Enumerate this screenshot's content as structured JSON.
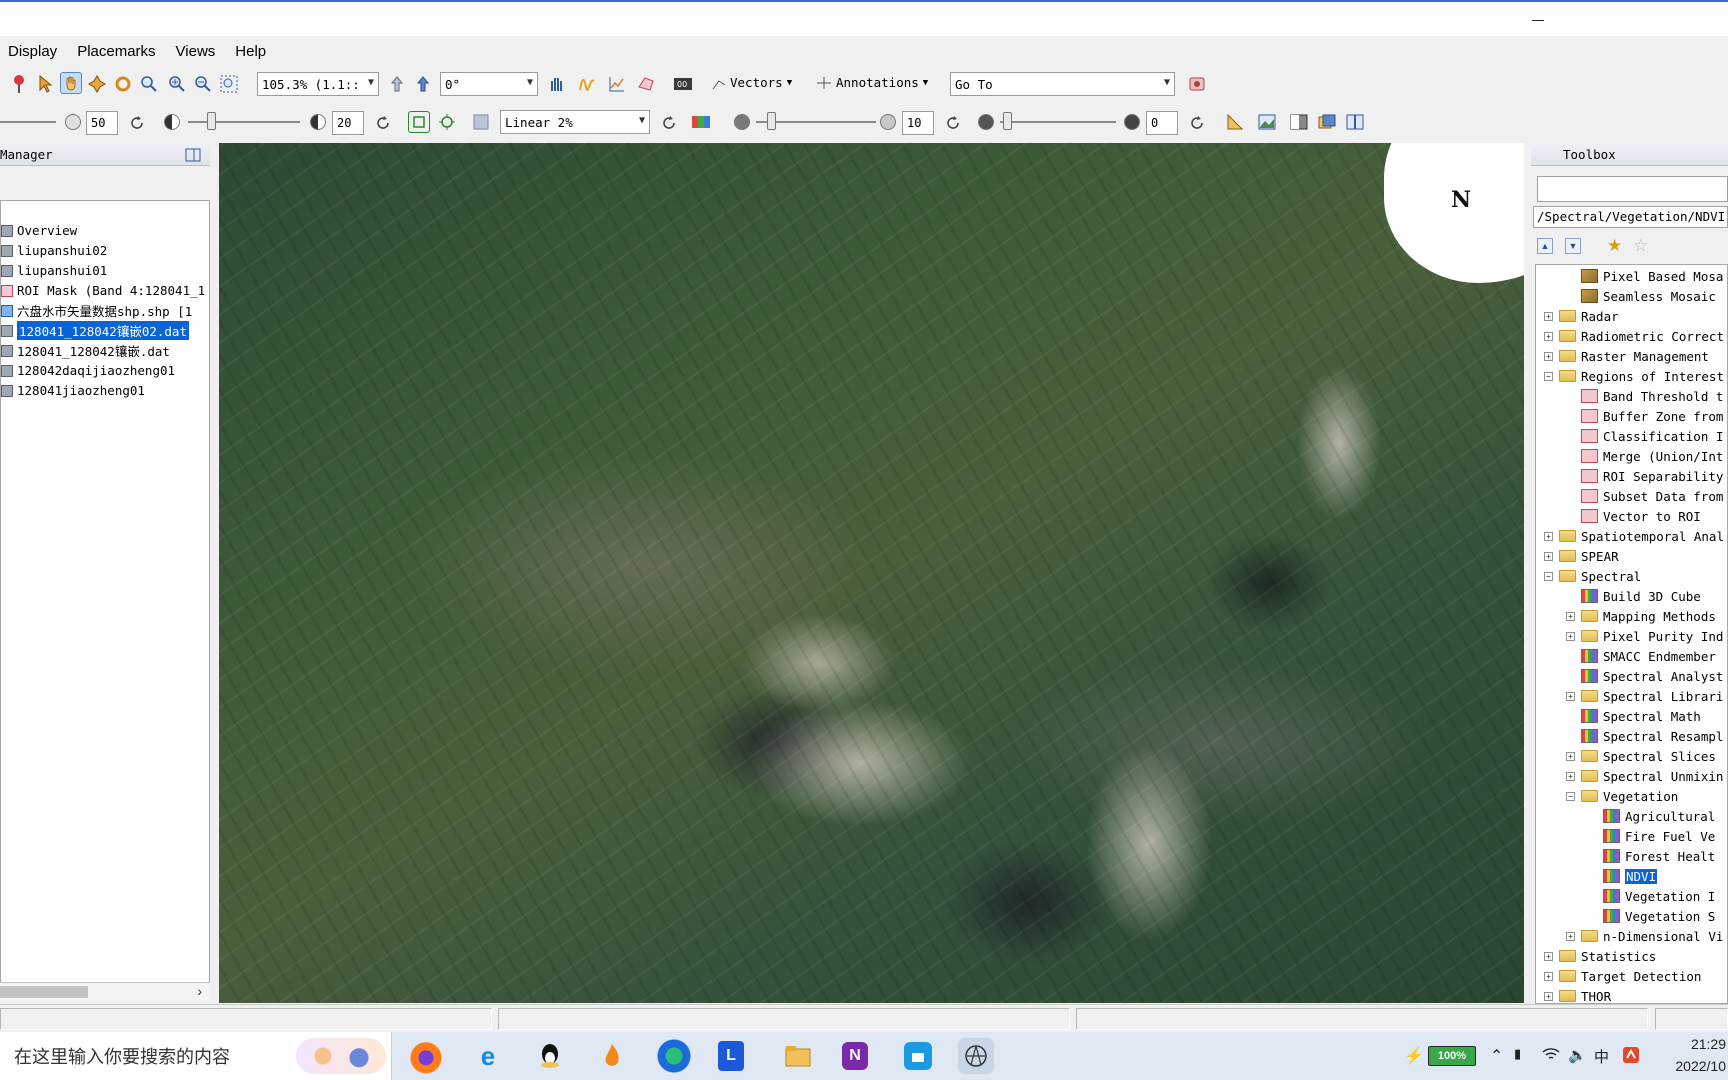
{
  "menu": [
    "Display",
    "Placemarks",
    "Views",
    "Help"
  ],
  "toolbar1": {
    "zoom_value": "105.3% (1.1::",
    "rotation_value": "0°",
    "vectors_label": "Vectors",
    "annotations_label": "Annotations",
    "goto_value": "Go To"
  },
  "toolbar2": {
    "brightness_value": "50",
    "contrast_value": "20",
    "stretch_value": "Linear 2%",
    "sharpen_value": "10",
    "transparency_value": "0"
  },
  "layer_manager": {
    "title": "Manager",
    "items": [
      {
        "label": "Overview"
      },
      {
        "label": "liupanshui02"
      },
      {
        "label": "liupanshui01"
      },
      {
        "label": "ROI Mask (Band 4:128041_1"
      },
      {
        "label": "六盘水市矢量数据shp.shp [1"
      },
      {
        "label": "128041_128042镶嵌02.dat"
      },
      {
        "label": "128041_128042镶嵌.dat"
      },
      {
        "label": "128042daqijiaozheng01"
      },
      {
        "label": "128041jiaozheng01"
      }
    ],
    "selected_index": 5
  },
  "image_view": {
    "north_label": "N"
  },
  "toolbox": {
    "title": "Toolbox",
    "search_value": "",
    "path": "/Spectral/Vegetation/NDVI",
    "tree": [
      {
        "label": "Pixel Based Mosa",
        "level": 2,
        "expander": "none",
        "icon": "mosaic"
      },
      {
        "label": "Seamless Mosaic",
        "level": 2,
        "expander": "none",
        "icon": "mosaic"
      },
      {
        "label": "Radar",
        "level": 1,
        "expander": "plus",
        "icon": "folder"
      },
      {
        "label": "Radiometric Correct",
        "level": 1,
        "expander": "plus",
        "icon": "folder"
      },
      {
        "label": "Raster Management",
        "level": 1,
        "expander": "plus",
        "icon": "folder"
      },
      {
        "label": "Regions of Interest",
        "level": 1,
        "expander": "minus",
        "icon": "folder"
      },
      {
        "label": "Band Threshold t",
        "level": 2,
        "expander": "none",
        "icon": "roi"
      },
      {
        "label": "Buffer Zone from",
        "level": 2,
        "expander": "none",
        "icon": "roi"
      },
      {
        "label": "Classification I",
        "level": 2,
        "expander": "none",
        "icon": "roi"
      },
      {
        "label": "Merge (Union/Int",
        "level": 2,
        "expander": "none",
        "icon": "roi"
      },
      {
        "label": "ROI Separability",
        "level": 2,
        "expander": "none",
        "icon": "roi"
      },
      {
        "label": "Subset Data from",
        "level": 2,
        "expander": "none",
        "icon": "roi"
      },
      {
        "label": "Vector to ROI",
        "level": 2,
        "expander": "none",
        "icon": "roi"
      },
      {
        "label": "Spatiotemporal Anal",
        "level": 1,
        "expander": "plus",
        "icon": "folder"
      },
      {
        "label": "SPEAR",
        "level": 1,
        "expander": "plus",
        "icon": "folder"
      },
      {
        "label": "Spectral",
        "level": 1,
        "expander": "minus",
        "icon": "folder"
      },
      {
        "label": "Build 3D Cube",
        "level": 2,
        "expander": "none",
        "icon": "spectral"
      },
      {
        "label": "Mapping Methods",
        "level": 2,
        "expander": "plus",
        "icon": "folder"
      },
      {
        "label": "Pixel Purity Ind",
        "level": 2,
        "expander": "plus",
        "icon": "folder"
      },
      {
        "label": "SMACC Endmember",
        "level": 2,
        "expander": "none",
        "icon": "spectral"
      },
      {
        "label": "Spectral Analyst",
        "level": 2,
        "expander": "none",
        "icon": "spectral"
      },
      {
        "label": "Spectral Librari",
        "level": 2,
        "expander": "plus",
        "icon": "folder"
      },
      {
        "label": "Spectral Math",
        "level": 2,
        "expander": "none",
        "icon": "spectral"
      },
      {
        "label": "Spectral Resampl",
        "level": 2,
        "expander": "none",
        "icon": "spectral"
      },
      {
        "label": "Spectral Slices",
        "level": 2,
        "expander": "plus",
        "icon": "folder"
      },
      {
        "label": "Spectral Unmixin",
        "level": 2,
        "expander": "plus",
        "icon": "folder"
      },
      {
        "label": "Vegetation",
        "level": 2,
        "expander": "minus",
        "icon": "folder"
      },
      {
        "label": "Agricultural",
        "level": 3,
        "expander": "none",
        "icon": "spectral"
      },
      {
        "label": "Fire Fuel Ve",
        "level": 3,
        "expander": "none",
        "icon": "spectral"
      },
      {
        "label": "Forest Healt",
        "level": 3,
        "expander": "none",
        "icon": "spectral"
      },
      {
        "label": "NDVI",
        "level": 3,
        "expander": "none",
        "icon": "spectral",
        "selected": true
      },
      {
        "label": "Vegetation I",
        "level": 3,
        "expander": "none",
        "icon": "spectral"
      },
      {
        "label": "Vegetation S",
        "level": 3,
        "expander": "none",
        "icon": "spectral"
      },
      {
        "label": "n-Dimensional Vi",
        "level": 2,
        "expander": "plus",
        "icon": "folder"
      },
      {
        "label": "Statistics",
        "level": 1,
        "expander": "plus",
        "icon": "folder"
      },
      {
        "label": "Target Detection",
        "level": 1,
        "expander": "plus",
        "icon": "folder"
      },
      {
        "label": "THOR",
        "level": 1,
        "expander": "plus",
        "icon": "folder"
      }
    ]
  },
  "taskbar": {
    "search_placeholder": "在这里输入你要搜索的内容",
    "battery": "100%",
    "time": "21:29",
    "date": "2022/10"
  },
  "colors": {
    "selection": "#0a64d8",
    "menu_bg": "#f0f0f0",
    "taskbar_bg": "#dfe8f3"
  }
}
